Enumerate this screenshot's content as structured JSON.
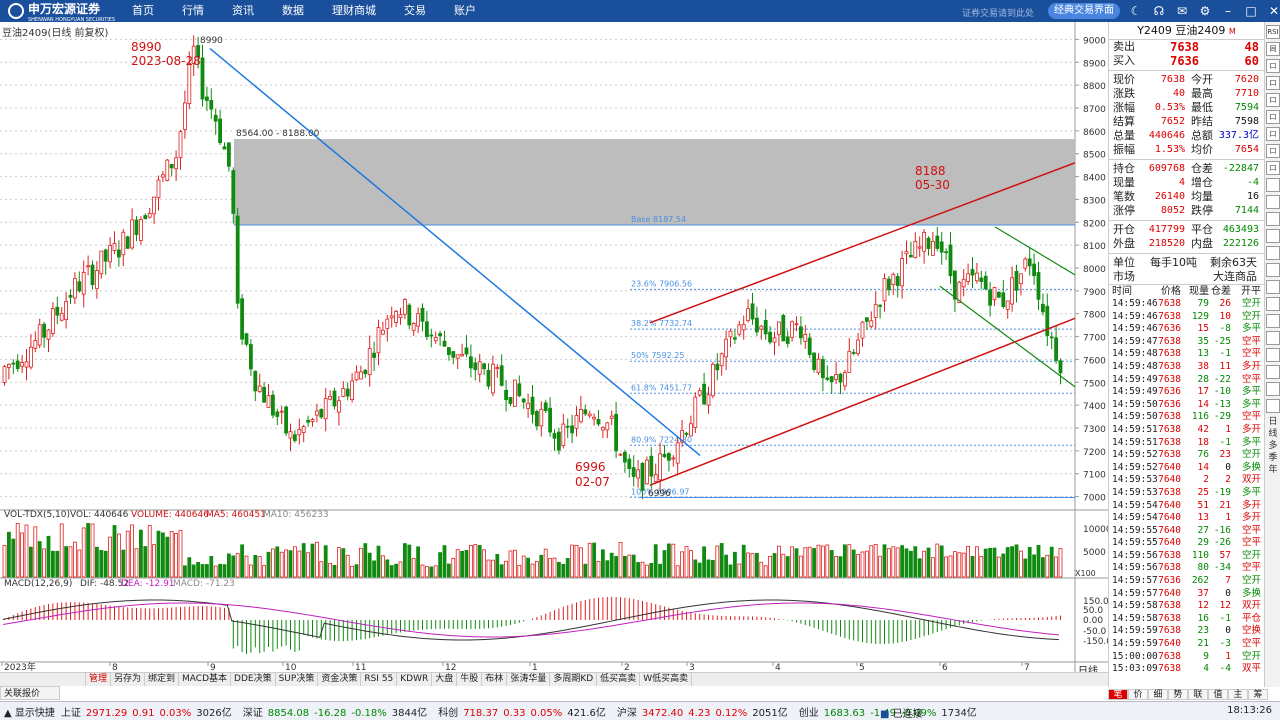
{
  "header": {
    "brand": "申万宏源证券",
    "brand_sub": "SHENWAN HONGYUAN SECURITIES",
    "nav": [
      "首页",
      "行情",
      "资讯",
      "数据",
      "理财商城",
      "交易",
      "账户"
    ],
    "slogan": "证券交易请到此处",
    "classic_button": "经典交易界面",
    "icons": [
      "moon-icon",
      "headset-icon",
      "mail-icon",
      "gear-icon",
      "minimize-icon",
      "maximize-icon",
      "close-icon"
    ]
  },
  "chart": {
    "title": "豆油2409(日线 前复权)",
    "high_price": "8990",
    "high_date": "2023-08-28",
    "high_tag": "8990",
    "range_label": "8564.00 - 8188.00",
    "low_price": "6996",
    "low_date": "02-07",
    "low_tag": "6996",
    "peak2_price": "8188",
    "peak2_date": "05-30",
    "fib_labels": [
      "Base 8187.54",
      "23.6% 7906.56",
      "38.2% 7732.74",
      "50% 7592.25",
      "61.8% 7451.77",
      "80.9% 7224.30",
      "100% 6996.97"
    ],
    "price_ticks": [
      "9000",
      "8900",
      "8800",
      "8700",
      "8600",
      "8500",
      "8400",
      "8300",
      "8200",
      "8100",
      "8000",
      "7900",
      "7800",
      "7700",
      "7600",
      "7500",
      "7400",
      "7300",
      "7200",
      "7100",
      "7000"
    ],
    "vol_title": "VOL-TDX(5,10)",
    "vol_val": "VOL: 440646",
    "vol_volume": "VOLUME: 440646",
    "vol_ma5": "MA5: 460451",
    "vol_ma10": "MA10: 456233",
    "vol_ticks": [
      "10000",
      "5000"
    ],
    "vol_unit": "X100",
    "macd_title": "MACD(12,26,9)",
    "macd_dif": "DIF: -48.52",
    "macd_dea": "DEA: -12.91",
    "macd_macd": "MACD: -71.23",
    "macd_ticks": [
      "150.0",
      "50.0",
      "0.00",
      "-50.0",
      "-150.0"
    ],
    "x_labels": [
      "2023年",
      "8",
      "9",
      "10",
      "11",
      "12",
      "1",
      "2",
      "3",
      "4",
      "5",
      "6",
      "7"
    ],
    "period": "日线",
    "colors": {
      "up": "#e02020",
      "down": "#108a10",
      "trend": "#1e78e0",
      "channel": "#d01010",
      "fib": "#4a90e2",
      "zone": "#bdbdbd"
    }
  },
  "chart_data": {
    "type": "candlestick",
    "series": [
      {
        "name": "price",
        "high": 8990,
        "low": 6996
      }
    ],
    "ylim": [
      6950,
      9050
    ]
  },
  "panel": {
    "title": "Y2409 豆油2409",
    "title_tag": "M",
    "bidask": [
      {
        "label": "卖出",
        "price": "7638",
        "vol": "48"
      },
      {
        "label": "买入",
        "price": "7636",
        "vol": "60"
      }
    ],
    "stats": [
      [
        "现价",
        "7638",
        "今开",
        "7620"
      ],
      [
        "涨跌",
        "40",
        "最高",
        "7710"
      ],
      [
        "涨幅",
        "0.53%",
        "最低",
        "7594"
      ],
      [
        "结算",
        "7652",
        "昨结",
        "7598"
      ],
      [
        "总量",
        "440646",
        "总额",
        "337.3亿"
      ],
      [
        "振幅",
        "1.53%",
        "均价",
        "7654"
      ]
    ],
    "stats2": [
      [
        "持仓",
        "609768",
        "仓差",
        "-22847"
      ],
      [
        "现量",
        "4",
        "增仓",
        "-4"
      ],
      [
        "笔数",
        "26140",
        "均量",
        "16"
      ],
      [
        "涨停",
        "8052",
        "跌停",
        "7144"
      ]
    ],
    "stats3": [
      [
        "开仓",
        "417799",
        "平仓",
        "463493"
      ],
      [
        "外盘",
        "218520",
        "内盘",
        "222126"
      ]
    ],
    "unit": [
      "单位",
      "每手10吨",
      "剩余63天"
    ],
    "market": [
      "市场",
      "大连商品"
    ],
    "tick_head": [
      "时间",
      "价格",
      "现量",
      "仓差",
      "开平"
    ],
    "ticks": [
      [
        "14:59:46",
        "7638",
        "79",
        "26",
        "空开"
      ],
      [
        "14:59:46",
        "7638",
        "129",
        "10",
        "空开"
      ],
      [
        "14:59:46",
        "7636",
        "15",
        "-8",
        "多平"
      ],
      [
        "14:59:47",
        "7638",
        "35",
        "-25",
        "空平"
      ],
      [
        "14:59:48",
        "7638",
        "13",
        "-1",
        "空平"
      ],
      [
        "14:59:48",
        "7638",
        "38",
        "11",
        "多开"
      ],
      [
        "14:59:49",
        "7638",
        "28",
        "-22",
        "空平"
      ],
      [
        "14:59:49",
        "7636",
        "17",
        "-10",
        "多平"
      ],
      [
        "14:59:50",
        "7636",
        "14",
        "-13",
        "多平"
      ],
      [
        "14:59:50",
        "7638",
        "116",
        "-29",
        "空平"
      ],
      [
        "14:59:51",
        "7638",
        "42",
        "1",
        "多开"
      ],
      [
        "14:59:51",
        "7638",
        "18",
        "-1",
        "多平"
      ],
      [
        "14:59:52",
        "7638",
        "76",
        "23",
        "空开"
      ],
      [
        "14:59:52",
        "7640",
        "14",
        "0",
        "多换"
      ],
      [
        "14:59:53",
        "7640",
        "2",
        "2",
        "双开"
      ],
      [
        "14:59:53",
        "7638",
        "25",
        "-19",
        "多平"
      ],
      [
        "14:59:54",
        "7640",
        "51",
        "21",
        "多开"
      ],
      [
        "14:59:54",
        "7640",
        "13",
        "1",
        "多开"
      ],
      [
        "14:59:55",
        "7640",
        "27",
        "-16",
        "空平"
      ],
      [
        "14:59:55",
        "7640",
        "29",
        "-26",
        "空平"
      ],
      [
        "14:59:56",
        "7638",
        "110",
        "57",
        "空开"
      ],
      [
        "14:59:56",
        "7638",
        "80",
        "-34",
        "空平"
      ],
      [
        "14:59:57",
        "7636",
        "262",
        "7",
        "空开"
      ],
      [
        "14:59:57",
        "7640",
        "37",
        "0",
        "多换"
      ],
      [
        "14:59:58",
        "7638",
        "12",
        "12",
        "双开"
      ],
      [
        "14:59:58",
        "7638",
        "16",
        "-1",
        "平仓"
      ],
      [
        "14:59:59",
        "7638",
        "23",
        "0",
        "空换"
      ],
      [
        "14:59:59",
        "7640",
        "21",
        "-3",
        "空平"
      ],
      [
        "15:00:00",
        "7638",
        "9",
        "1",
        "空开"
      ],
      [
        "15:03:09",
        "7638",
        "4",
        "-4",
        "双平"
      ]
    ]
  },
  "sidebar": [
    "RSI",
    "同",
    "口",
    "口",
    "口",
    "口",
    "口",
    "口",
    "口"
  ],
  "sidebar_text": [
    "日",
    "线",
    "多",
    "季",
    "年"
  ],
  "tabs": [
    "管理",
    "另存为",
    "绑定到",
    "MACD基本",
    "DDE决策",
    "SUP决策",
    "资金决策",
    "RSI 55",
    "KDWR",
    "大盘",
    "牛股",
    "布林",
    "张涛华量",
    "多周期KD",
    "低买高卖",
    "W低买高卖"
  ],
  "quote_tab": "关联报价",
  "rtabs": [
    "笔",
    "价",
    "细",
    "势",
    "联",
    "值",
    "主",
    "筹"
  ],
  "status": {
    "menu": "显示快捷",
    "items": [
      [
        "上证",
        "2971.29",
        "0.91",
        "0.03%",
        "3026亿"
      ],
      [
        "深证",
        "8854.08",
        "-16.28",
        "-0.18%",
        "3844亿"
      ],
      [
        "科创",
        "718.37",
        "0.33",
        "0.05%",
        "421.6亿"
      ],
      [
        "沪深",
        "3472.40",
        "4.23",
        "0.12%",
        "2051亿"
      ],
      [
        "创业",
        "1683.63",
        "-1.49",
        "-0.09%",
        "1734亿"
      ]
    ],
    "conn": "已连接",
    "time": "18:13:26"
  },
  "zoom": [
    "+",
    "-"
  ]
}
